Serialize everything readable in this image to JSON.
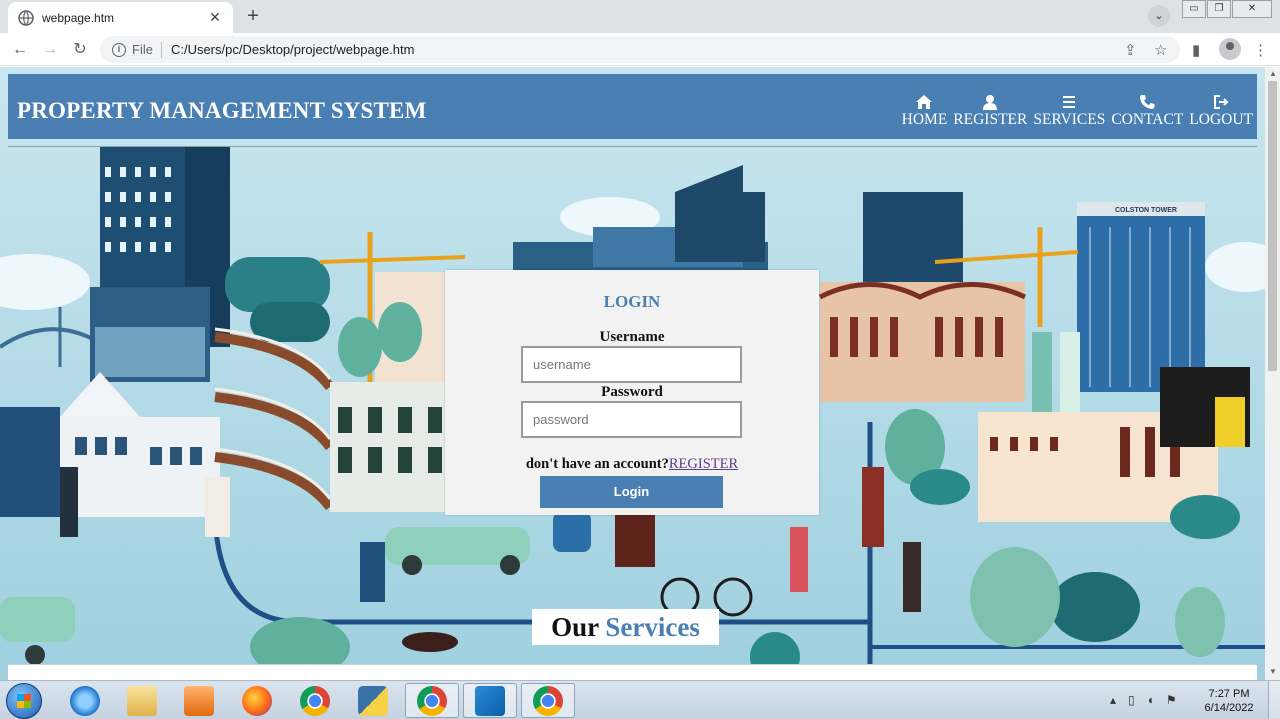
{
  "browser": {
    "tab_title": "webpage.htm",
    "address_label": "File",
    "address_url": "C:/Users/pc/Desktop/project/webpage.htm"
  },
  "site": {
    "brand": "PROPERTY MANAGEMENT SYSTEM",
    "nav": [
      {
        "label": "HOME",
        "icon": "home-icon"
      },
      {
        "label": "REGISTER",
        "icon": "user-icon"
      },
      {
        "label": "SERVICES",
        "icon": "bars-icon"
      },
      {
        "label": "CONTACT",
        "icon": "phone-icon"
      },
      {
        "label": "LOGOUT",
        "icon": "sign-out-icon"
      }
    ],
    "colors": {
      "accent": "#4a7fb4"
    }
  },
  "login": {
    "title": "LOGIN",
    "username_label": "Username",
    "username_placeholder": "username",
    "password_label": "Password",
    "password_placeholder": "password",
    "register_prompt": "don't have an account?",
    "register_link": "REGISTER",
    "submit_label": "Login"
  },
  "illustration": {
    "building_sign": "COLSTON TOWER"
  },
  "services": {
    "word1": "Our",
    "word2": "Services"
  },
  "taskbar": {
    "apps": [
      "internet-explorer",
      "file-explorer",
      "media-player",
      "firefox",
      "chrome",
      "python",
      "chrome",
      "vscode",
      "chrome"
    ],
    "time": "7:27 PM",
    "date": "6/14/2022"
  }
}
